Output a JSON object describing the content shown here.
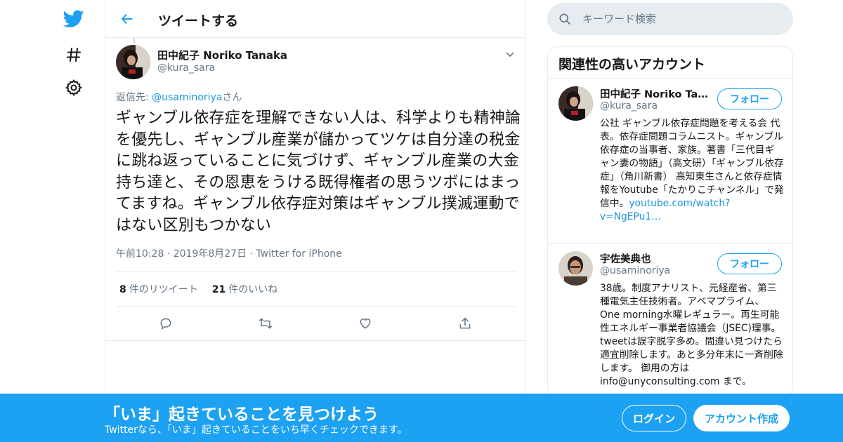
{
  "colors": {
    "brand": "#1da1f2",
    "link": "#1b95e0",
    "text": "#14171a",
    "muted": "#657786",
    "border": "#e6ecf0"
  },
  "nav": {
    "icons": [
      "twitter-bird-icon",
      "hashtag-icon",
      "gear-icon"
    ]
  },
  "header": {
    "title": "ツイートする"
  },
  "tweet": {
    "name": "田中紀子 Noriko Tanaka",
    "handle": "@kura_sara",
    "reply_prefix": "返信先: ",
    "reply_mention": "@usaminoriya",
    "reply_suffix": "さん",
    "text": "ギャンブル依存症を理解できない人は、科学よりも精神論を優先し、ギャンブル産業が儲かってツケは自分達の税金に跳ね返っていることに気づけず、ギャンブル産業の大金持ち達と、その恩恵をうける既得権者の思うツボにはまってますね。ギャンブル依存症対策はギャンブル撲滅運動ではない区別もつかない",
    "time": "午前10:28",
    "date": "2019年8月27日",
    "source": "Twitter for iPhone",
    "retweets_count": "8",
    "retweets_label": "件のリツイート",
    "likes_count": "21",
    "likes_label": "件のいいね"
  },
  "search": {
    "placeholder": "キーワード検索"
  },
  "related": {
    "title": "関連性の高いアカウント",
    "accounts": [
      {
        "name": "田中紀子 Noriko Tanaka",
        "handle": "@kura_sara",
        "follow_label": "フォロー",
        "bio": "公社 ギャンブル依存症問題を考える会 代表。依存症問題コラムニスト。ギャンブル依存症の当事者、家族。著書「三代目ギャン妻の物語」（高文研）「ギャンブル依存症」（角川新書） 高知東生さんと依存症情報をYoutube「たかりこチャンネル」で発信中。",
        "bio_link": "youtube.com/watch?v=NgEPu1…"
      },
      {
        "name": "宇佐美典也",
        "handle": "@usaminoriya",
        "follow_label": "フォロー",
        "bio": "38歳。制度アナリスト、元経産省、第三種電気主任技術者。アベマプライム、One morning水曜レギュラー。再生可能性エネルギー事業者協議会（JSEC)理事。tweetは誤字脱字多め。間違い見つけたら適宜削除します。あと多分年末に一斉削除します。 御用の方はinfo@unyconsulting.com まで。"
      }
    ]
  },
  "banner": {
    "title": "「いま」起きていることを見つけよう",
    "subtitle": "Twitterなら、「いま」起きていることをいち早くチェックできます。",
    "login_label": "ログイン",
    "signup_label": "アカウント作成"
  }
}
